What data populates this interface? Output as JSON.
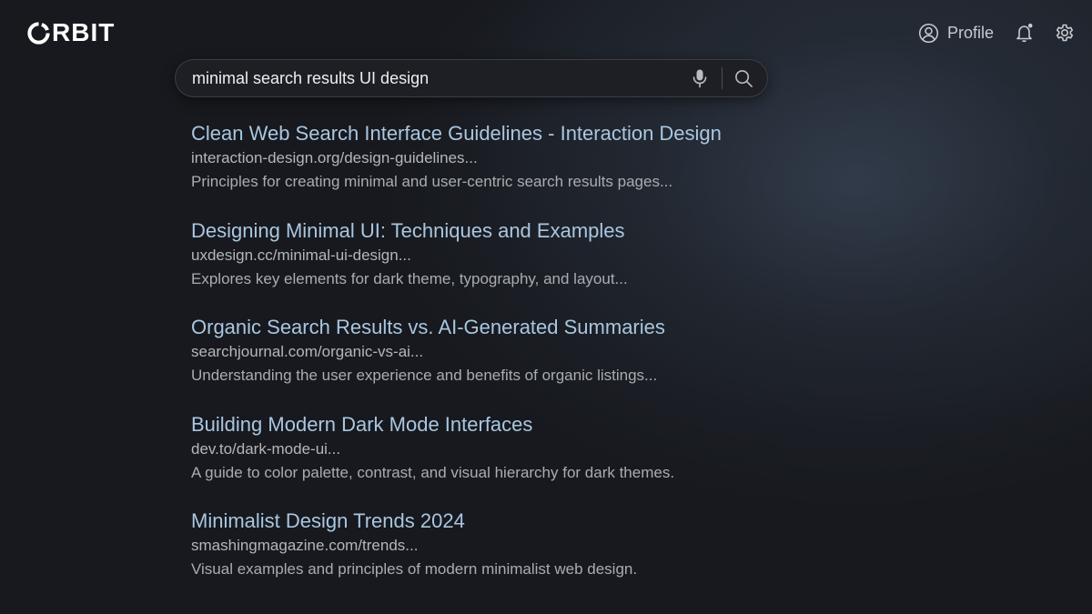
{
  "app": {
    "logo_text": "RBIT",
    "logo_full": "ORBIT"
  },
  "header": {
    "profile_label": "Profile",
    "profile_icon": "user-circle-icon",
    "notifications_icon": "bell-icon",
    "settings_icon": "gear-icon"
  },
  "search": {
    "query": "minimal search results UI design",
    "mic_icon": "microphone-icon",
    "search_icon": "search-icon"
  },
  "results": [
    {
      "title": "Clean Web Search Interface Guidelines - Interaction Design",
      "url": "interaction-design.org/design-guidelines...",
      "snippet": "Principles for creating minimal and user-centric search results pages..."
    },
    {
      "title": "Designing Minimal UI: Techniques and Examples",
      "url": "uxdesign.cc/minimal-ui-design...",
      "snippet": "Explores key elements for dark theme, typography, and layout..."
    },
    {
      "title": "Organic Search Results vs. AI-Generated Summaries",
      "url": "searchjournal.com/organic-vs-ai...",
      "snippet": "Understanding the user experience and benefits of organic listings..."
    },
    {
      "title": "Building Modern Dark Mode Interfaces",
      "url": "dev.to/dark-mode-ui...",
      "snippet": "A guide to color palette, contrast, and visual hierarchy for dark themes."
    },
    {
      "title": "Minimalist Design Trends 2024",
      "url": "smashingmagazine.com/trends...",
      "snippet": "Visual examples and principles of modern minimalist web design."
    }
  ],
  "colors": {
    "background": "#141518",
    "title_link": "#a9c6e0",
    "url_text": "#b3b6bb",
    "snippet_text": "#a9acb1",
    "logo": "#ffffff"
  }
}
